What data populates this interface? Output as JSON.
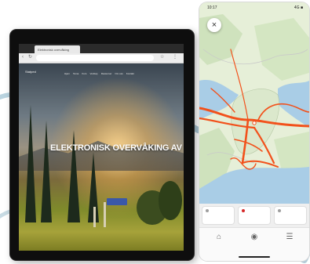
{
  "tablet": {
    "browser_tab_label": "Elektronisk overvåking",
    "site_logo": "Statped",
    "menu_items": [
      "Hjem",
      "Tema",
      "Kurs",
      "Verktøy",
      "Ressurser",
      "Om oss",
      "Kontakt"
    ],
    "hero_title": "ELEKTRONISK OVERVÅKING AV ELEVER",
    "hero_subtitle": "",
    "hero_button": ""
  },
  "phone": {
    "status_time": "10:17",
    "status_right": "4G ■",
    "close_icon": "close-icon",
    "cards": [
      {
        "text": "",
        "dot_color": "#9e9e9e"
      },
      {
        "text": "",
        "dot_color": "#d62828"
      },
      {
        "text": "",
        "dot_color": "#9e9e9e"
      }
    ],
    "tabs": [
      {
        "icon": "home-icon",
        "glyph": "⌂",
        "label": ""
      },
      {
        "icon": "globe-icon",
        "glyph": "◉",
        "label": ""
      },
      {
        "icon": "menu-icon",
        "glyph": "☰",
        "label": ""
      }
    ]
  },
  "colors": {
    "route": "#f2511b",
    "water": "#a9cde6",
    "land": "#e8f0dc",
    "button": "#3a58a8"
  }
}
